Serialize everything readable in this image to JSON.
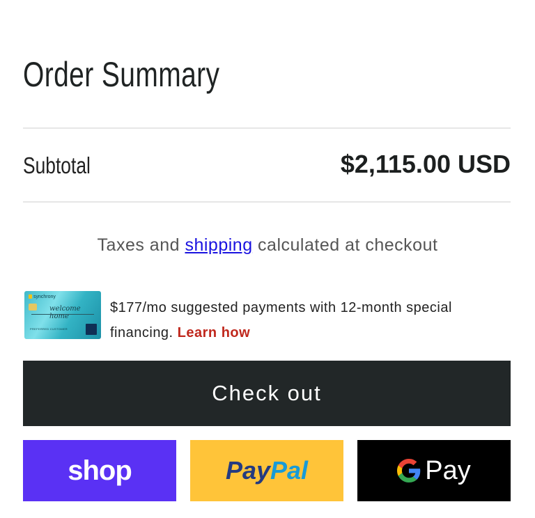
{
  "summary": {
    "title": "Order Summary",
    "subtotal_label": "Subtotal",
    "subtotal_value": "$2,115.00 USD"
  },
  "tax_note": {
    "before": "Taxes and ",
    "link": "shipping",
    "after": " calculated at checkout"
  },
  "financing": {
    "card_brand": "synchrony",
    "card_script": "welcome home",
    "card_holder": "PREFERRED CUSTOMER",
    "text": "$177/mo suggested payments with 12-month special financing. ",
    "learn_link": "Learn how"
  },
  "checkout": {
    "button_label": "Check out"
  },
  "payment_buttons": {
    "shop": "shop",
    "paypal_pay": "Pay",
    "paypal_pal": "Pal",
    "gpay": "Pay",
    "colors": {
      "shop": "#5a31f4",
      "paypal": "#ffc439",
      "gpay": "#000000"
    }
  }
}
